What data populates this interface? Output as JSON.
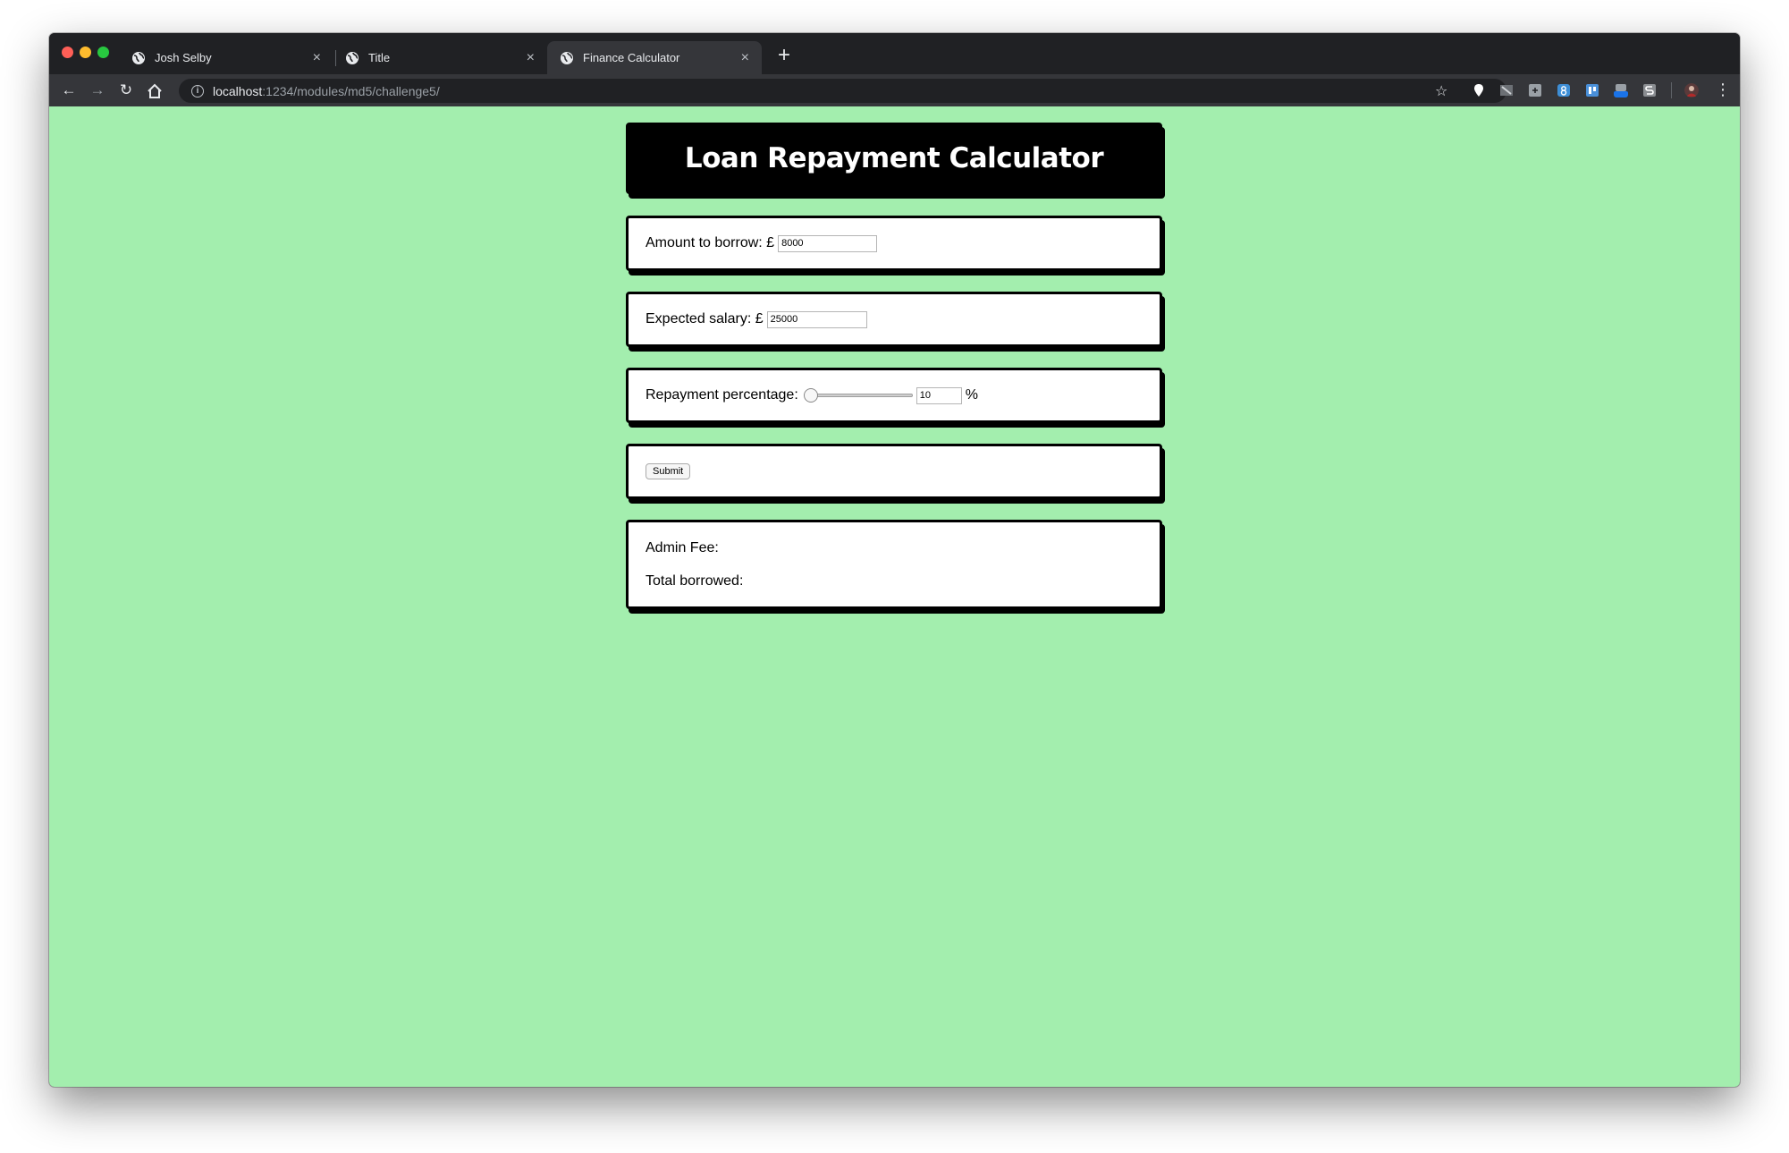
{
  "browser": {
    "tabs": [
      {
        "title": "Josh Selby",
        "active": false
      },
      {
        "title": "Title",
        "active": false
      },
      {
        "title": "Finance Calculator",
        "active": true
      }
    ],
    "new_tab_symbol": "+",
    "close_symbol": "×",
    "address": {
      "host": "localhost",
      "path": ":1234/modules/md5/challenge5/"
    }
  },
  "page": {
    "title": "Loan Repayment Calculator",
    "background_color": "#a3eeae",
    "amount": {
      "label": "Amount to borrow: £",
      "value": "8000"
    },
    "salary": {
      "label": "Expected salary: £",
      "value": "25000"
    },
    "repayment": {
      "label": "Repayment percentage:",
      "slider_fraction": 0.0,
      "value": "10",
      "unit": "%"
    },
    "submit_label": "Submit",
    "results": {
      "admin_fee_label": "Admin Fee:",
      "total_borrowed_label": "Total borrowed:"
    }
  }
}
